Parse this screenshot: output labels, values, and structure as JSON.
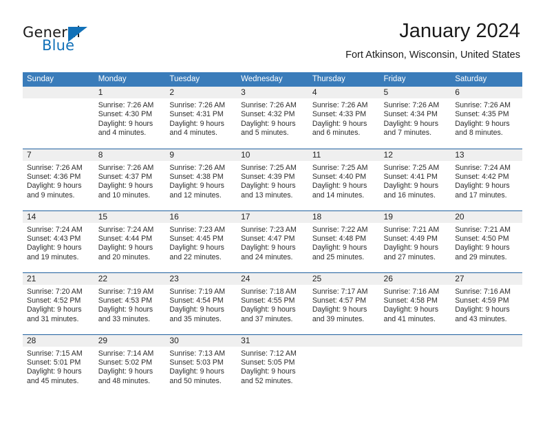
{
  "brand": {
    "word1": "General",
    "word2": "Blue",
    "accent_color": "#1271b8",
    "logo_icon": "triangle-logo-icon"
  },
  "header": {
    "title": "January 2024",
    "subtitle": "Fort Atkinson, Wisconsin, United States"
  },
  "calendar": {
    "header_bg": "#3a7cba",
    "row_divider": "#1e5f9e",
    "daynum_bg": "#efefef",
    "weekdays": [
      "Sunday",
      "Monday",
      "Tuesday",
      "Wednesday",
      "Thursday",
      "Friday",
      "Saturday"
    ],
    "weeks": [
      [
        {
          "day": "",
          "lines": []
        },
        {
          "day": "1",
          "lines": [
            "Sunrise: 7:26 AM",
            "Sunset: 4:30 PM",
            "Daylight: 9 hours",
            "and 4 minutes."
          ]
        },
        {
          "day": "2",
          "lines": [
            "Sunrise: 7:26 AM",
            "Sunset: 4:31 PM",
            "Daylight: 9 hours",
            "and 4 minutes."
          ]
        },
        {
          "day": "3",
          "lines": [
            "Sunrise: 7:26 AM",
            "Sunset: 4:32 PM",
            "Daylight: 9 hours",
            "and 5 minutes."
          ]
        },
        {
          "day": "4",
          "lines": [
            "Sunrise: 7:26 AM",
            "Sunset: 4:33 PM",
            "Daylight: 9 hours",
            "and 6 minutes."
          ]
        },
        {
          "day": "5",
          "lines": [
            "Sunrise: 7:26 AM",
            "Sunset: 4:34 PM",
            "Daylight: 9 hours",
            "and 7 minutes."
          ]
        },
        {
          "day": "6",
          "lines": [
            "Sunrise: 7:26 AM",
            "Sunset: 4:35 PM",
            "Daylight: 9 hours",
            "and 8 minutes."
          ]
        }
      ],
      [
        {
          "day": "7",
          "lines": [
            "Sunrise: 7:26 AM",
            "Sunset: 4:36 PM",
            "Daylight: 9 hours",
            "and 9 minutes."
          ]
        },
        {
          "day": "8",
          "lines": [
            "Sunrise: 7:26 AM",
            "Sunset: 4:37 PM",
            "Daylight: 9 hours",
            "and 10 minutes."
          ]
        },
        {
          "day": "9",
          "lines": [
            "Sunrise: 7:26 AM",
            "Sunset: 4:38 PM",
            "Daylight: 9 hours",
            "and 12 minutes."
          ]
        },
        {
          "day": "10",
          "lines": [
            "Sunrise: 7:25 AM",
            "Sunset: 4:39 PM",
            "Daylight: 9 hours",
            "and 13 minutes."
          ]
        },
        {
          "day": "11",
          "lines": [
            "Sunrise: 7:25 AM",
            "Sunset: 4:40 PM",
            "Daylight: 9 hours",
            "and 14 minutes."
          ]
        },
        {
          "day": "12",
          "lines": [
            "Sunrise: 7:25 AM",
            "Sunset: 4:41 PM",
            "Daylight: 9 hours",
            "and 16 minutes."
          ]
        },
        {
          "day": "13",
          "lines": [
            "Sunrise: 7:24 AM",
            "Sunset: 4:42 PM",
            "Daylight: 9 hours",
            "and 17 minutes."
          ]
        }
      ],
      [
        {
          "day": "14",
          "lines": [
            "Sunrise: 7:24 AM",
            "Sunset: 4:43 PM",
            "Daylight: 9 hours",
            "and 19 minutes."
          ]
        },
        {
          "day": "15",
          "lines": [
            "Sunrise: 7:24 AM",
            "Sunset: 4:44 PM",
            "Daylight: 9 hours",
            "and 20 minutes."
          ]
        },
        {
          "day": "16",
          "lines": [
            "Sunrise: 7:23 AM",
            "Sunset: 4:45 PM",
            "Daylight: 9 hours",
            "and 22 minutes."
          ]
        },
        {
          "day": "17",
          "lines": [
            "Sunrise: 7:23 AM",
            "Sunset: 4:47 PM",
            "Daylight: 9 hours",
            "and 24 minutes."
          ]
        },
        {
          "day": "18",
          "lines": [
            "Sunrise: 7:22 AM",
            "Sunset: 4:48 PM",
            "Daylight: 9 hours",
            "and 25 minutes."
          ]
        },
        {
          "day": "19",
          "lines": [
            "Sunrise: 7:21 AM",
            "Sunset: 4:49 PM",
            "Daylight: 9 hours",
            "and 27 minutes."
          ]
        },
        {
          "day": "20",
          "lines": [
            "Sunrise: 7:21 AM",
            "Sunset: 4:50 PM",
            "Daylight: 9 hours",
            "and 29 minutes."
          ]
        }
      ],
      [
        {
          "day": "21",
          "lines": [
            "Sunrise: 7:20 AM",
            "Sunset: 4:52 PM",
            "Daylight: 9 hours",
            "and 31 minutes."
          ]
        },
        {
          "day": "22",
          "lines": [
            "Sunrise: 7:19 AM",
            "Sunset: 4:53 PM",
            "Daylight: 9 hours",
            "and 33 minutes."
          ]
        },
        {
          "day": "23",
          "lines": [
            "Sunrise: 7:19 AM",
            "Sunset: 4:54 PM",
            "Daylight: 9 hours",
            "and 35 minutes."
          ]
        },
        {
          "day": "24",
          "lines": [
            "Sunrise: 7:18 AM",
            "Sunset: 4:55 PM",
            "Daylight: 9 hours",
            "and 37 minutes."
          ]
        },
        {
          "day": "25",
          "lines": [
            "Sunrise: 7:17 AM",
            "Sunset: 4:57 PM",
            "Daylight: 9 hours",
            "and 39 minutes."
          ]
        },
        {
          "day": "26",
          "lines": [
            "Sunrise: 7:16 AM",
            "Sunset: 4:58 PM",
            "Daylight: 9 hours",
            "and 41 minutes."
          ]
        },
        {
          "day": "27",
          "lines": [
            "Sunrise: 7:16 AM",
            "Sunset: 4:59 PM",
            "Daylight: 9 hours",
            "and 43 minutes."
          ]
        }
      ],
      [
        {
          "day": "28",
          "lines": [
            "Sunrise: 7:15 AM",
            "Sunset: 5:01 PM",
            "Daylight: 9 hours",
            "and 45 minutes."
          ]
        },
        {
          "day": "29",
          "lines": [
            "Sunrise: 7:14 AM",
            "Sunset: 5:02 PM",
            "Daylight: 9 hours",
            "and 48 minutes."
          ]
        },
        {
          "day": "30",
          "lines": [
            "Sunrise: 7:13 AM",
            "Sunset: 5:03 PM",
            "Daylight: 9 hours",
            "and 50 minutes."
          ]
        },
        {
          "day": "31",
          "lines": [
            "Sunrise: 7:12 AM",
            "Sunset: 5:05 PM",
            "Daylight: 9 hours",
            "and 52 minutes."
          ]
        },
        {
          "day": "",
          "lines": []
        },
        {
          "day": "",
          "lines": []
        },
        {
          "day": "",
          "lines": []
        }
      ]
    ]
  }
}
